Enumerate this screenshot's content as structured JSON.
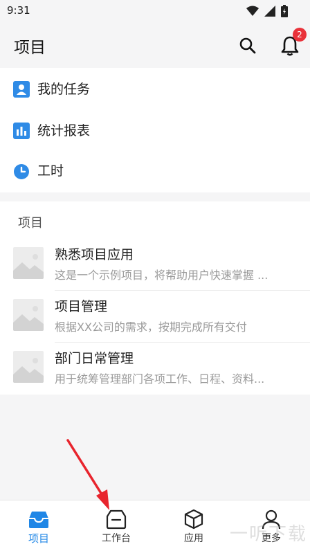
{
  "status": {
    "time": "9:31"
  },
  "header": {
    "title": "项目",
    "notification_count": "2"
  },
  "quick_links": [
    {
      "label": "我的任务",
      "icon": "user-card-icon"
    },
    {
      "label": "统计报表",
      "icon": "bar-chart-icon"
    },
    {
      "label": "工时",
      "icon": "clock-icon"
    }
  ],
  "projects_section": {
    "label": "项目",
    "items": [
      {
        "name": "熟悉项目应用",
        "desc": "这是一个示例项目，将帮助用户快速掌握 ..."
      },
      {
        "name": "项目管理",
        "desc": "根据XX公司的需求，按期完成所有交付"
      },
      {
        "name": "部门日常管理",
        "desc": "用于统筹管理部门各项工作、日程、资料..."
      }
    ]
  },
  "tabs": [
    {
      "label": "项目",
      "icon": "inbox-tray-icon",
      "active": true
    },
    {
      "label": "工作台",
      "icon": "workbench-icon",
      "active": false
    },
    {
      "label": "应用",
      "icon": "cube-icon",
      "active": false
    },
    {
      "label": "更多",
      "icon": "person-icon",
      "active": false
    }
  ],
  "watermark": "一听下载",
  "colors": {
    "accent": "#1f86e6",
    "badge": "#e9323a",
    "arrow": "#e8242d"
  }
}
